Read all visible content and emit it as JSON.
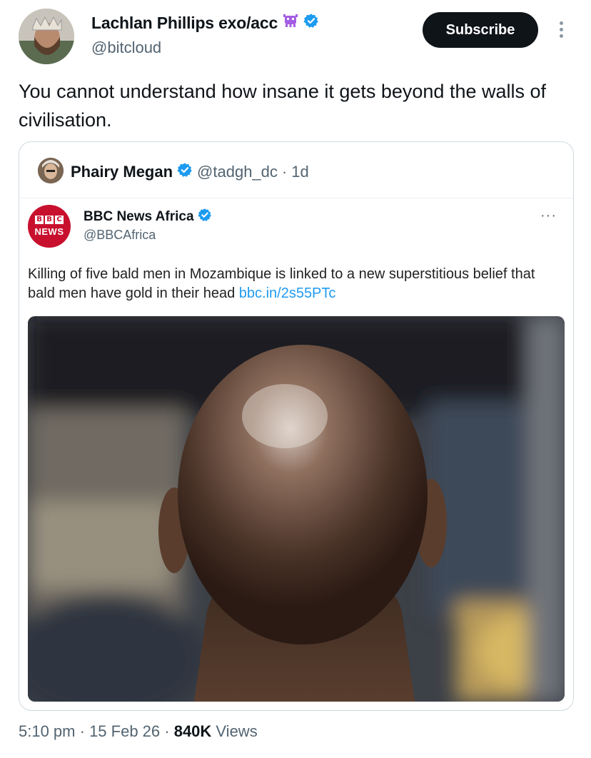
{
  "author": {
    "display_name": "Lachlan Phillips exo/acc",
    "handle": "@bitcloud",
    "emoji_icon": "alien-monster-icon",
    "verified_icon": "verified-badge-icon"
  },
  "subscribe_label": "Subscribe",
  "tweet": {
    "text": "You cannot understand how insane it gets beyond the walls of civilisation."
  },
  "quote": {
    "author_name": "Phairy Megan",
    "handle": "@tadgh_dc",
    "separator": "·",
    "age": "1d",
    "embedded": {
      "logo_blocks": [
        "B",
        "B",
        "C"
      ],
      "logo_text": "NEWS",
      "name": "BBC News Africa",
      "handle": "@BBCAfrica",
      "more": "···",
      "text": "Killing of five bald men in Mozambique is linked to a new superstitious belief that bald men have gold in their head ",
      "link": "bbc.in/2s55PTc"
    }
  },
  "footer": {
    "time": "5:10 pm",
    "sep1": " · ",
    "date": "15 Feb 26",
    "sep2": " · ",
    "views_count": "840K",
    "views_label": " Views"
  },
  "colors": {
    "link": "#1d9bf0",
    "verified": "#1d9bf0",
    "bbc_red": "#c8102e"
  }
}
